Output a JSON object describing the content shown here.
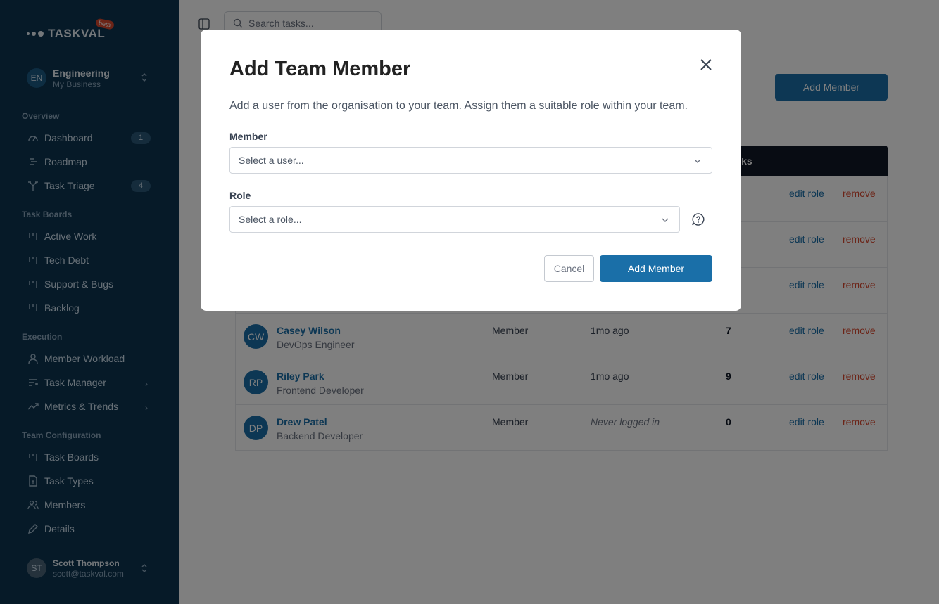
{
  "sidebar": {
    "logo_text": "TASKVAL",
    "beta": "beta",
    "org": {
      "initials": "EN",
      "name": "Engineering",
      "sub": "My Business"
    },
    "sections": {
      "overview": "Overview",
      "task_boards": "Task Boards",
      "execution": "Execution",
      "team_config": "Team Configuration"
    },
    "items": {
      "dashboard": {
        "label": "Dashboard",
        "badge": "1"
      },
      "roadmap": {
        "label": "Roadmap"
      },
      "task_triage": {
        "label": "Task Triage",
        "badge": "4"
      },
      "active_work": {
        "label": "Active Work"
      },
      "tech_debt": {
        "label": "Tech Debt"
      },
      "support_bugs": {
        "label": "Support & Bugs"
      },
      "backlog": {
        "label": "Backlog"
      },
      "member_workload": {
        "label": "Member Workload"
      },
      "task_manager": {
        "label": "Task Manager"
      },
      "metrics_trends": {
        "label": "Metrics & Trends"
      },
      "task_boards_cfg": {
        "label": "Task Boards"
      },
      "task_types": {
        "label": "Task Types"
      },
      "members": {
        "label": "Members"
      },
      "details": {
        "label": "Details"
      }
    },
    "user": {
      "initials": "ST",
      "name": "Scott Thompson",
      "email": "scott@taskval.com"
    }
  },
  "main": {
    "search_placeholder": "Search tasks...",
    "add_member_label": "Add Member",
    "table_header_tasks": "Tasks",
    "rows": [
      {
        "edit": "edit role",
        "remove": "remove"
      },
      {
        "edit": "edit role",
        "remove": "remove"
      },
      {
        "edit": "edit role",
        "remove": "remove"
      },
      {
        "initials": "CW",
        "name": "Casey Wilson",
        "title": "DevOps Engineer",
        "role": "Member",
        "login": "1mo ago",
        "tasks": "7",
        "edit": "edit role",
        "remove": "remove"
      },
      {
        "initials": "RP",
        "name": "Riley Park",
        "title": "Frontend Developer",
        "role": "Member",
        "login": "1mo ago",
        "tasks": "9",
        "edit": "edit role",
        "remove": "remove"
      },
      {
        "initials": "DP",
        "name": "Drew Patel",
        "title": "Backend Developer",
        "role": "Member",
        "login": "Never logged in",
        "tasks": "0",
        "edit": "edit role",
        "remove": "remove"
      }
    ]
  },
  "modal": {
    "title": "Add Team Member",
    "description": "Add a user from the organisation to your team. Assign them a suitable role within your team.",
    "member_label": "Member",
    "member_placeholder": "Select a user...",
    "role_label": "Role",
    "role_placeholder": "Select a role...",
    "cancel_label": "Cancel",
    "submit_label": "Add Member"
  },
  "colors": {
    "sidebar_bg": "#0c3450",
    "accent": "#1a6fa8",
    "danger": "#d9482f"
  }
}
